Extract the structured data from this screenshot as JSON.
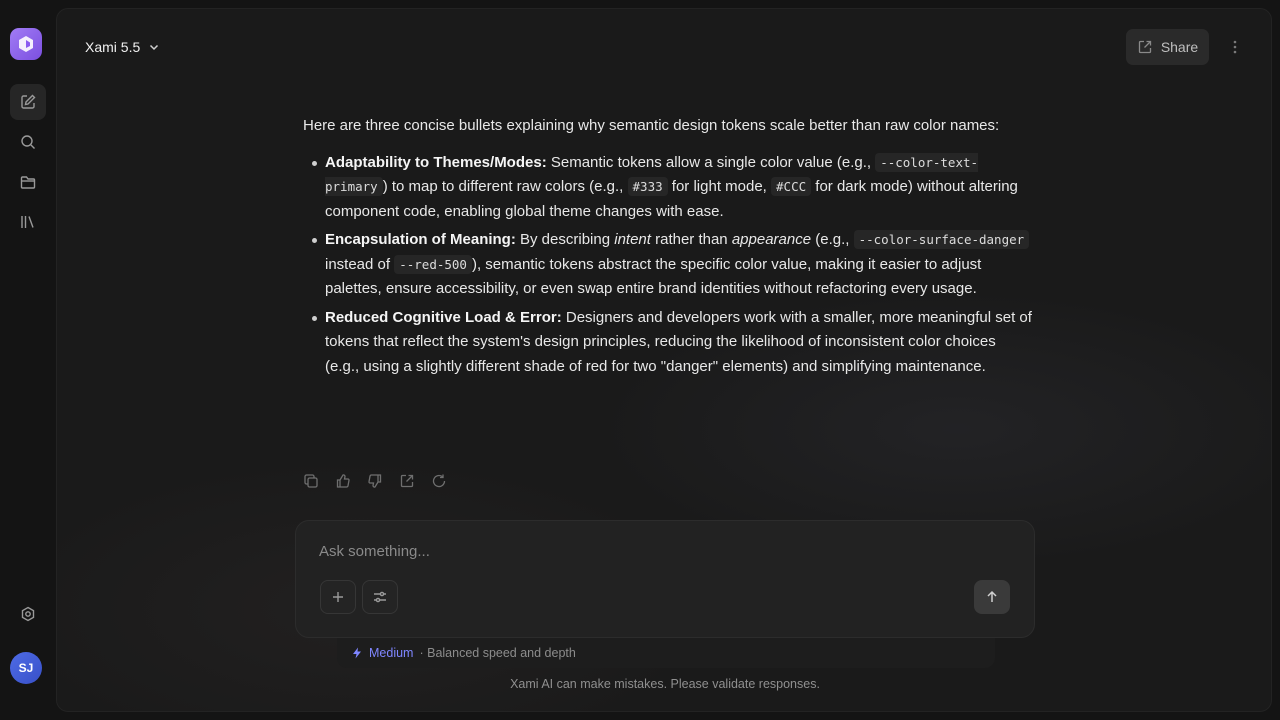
{
  "app": {
    "model_name": "Xami 5.5",
    "share_label": "Share",
    "user_initials": "SJ",
    "brand_color": "#8b5cf6"
  },
  "sidebar": {
    "items": [
      {
        "name": "new-chat",
        "icon": "edit-icon"
      },
      {
        "name": "search",
        "icon": "search-icon"
      },
      {
        "name": "projects",
        "icon": "folder-icon"
      },
      {
        "name": "library",
        "icon": "library-icon"
      },
      {
        "name": "settings",
        "icon": "gear-icon"
      }
    ]
  },
  "message": {
    "intro": "Here are three concise bullets explaining why semantic design tokens scale better than raw color names:",
    "bullets": [
      {
        "title": "Adaptability to Themes/Modes:",
        "t1": " Semantic tokens allow a single color value (e.g., ",
        "c1": "--color-text-primary",
        "t2": ") to map to different raw colors (e.g., ",
        "c2": "#333",
        "t3": " for light mode, ",
        "c3": "#CCC",
        "t4": " for dark mode) without altering component code, enabling global theme changes with ease."
      },
      {
        "title": "Encapsulation of Meaning:",
        "t1": " By describing ",
        "i1": "intent",
        "t2": " rather than ",
        "i2": "appearance",
        "t3": " (e.g., ",
        "c1": "--color-surface-danger",
        "t4": " instead of ",
        "c2": "--red-500",
        "t5": "), semantic tokens abstract the specific color value, making it easier to adjust palettes, ensure accessibility, or even swap entire brand identities without refactoring every usage."
      },
      {
        "title": "Reduced Cognitive Load & Error:",
        "t1": " Designers and developers work with a smaller, more meaningful set of tokens that reflect the system's design principles, reducing the likelihood of inconsistent color choices (e.g., using a slightly different shade of red for two \"danger\" elements) and simplifying maintenance."
      }
    ],
    "actions": [
      "copy-icon",
      "thumbs-up-icon",
      "thumbs-down-icon",
      "share-icon",
      "regenerate-icon"
    ]
  },
  "composer": {
    "placeholder": "Ask something...",
    "value": ""
  },
  "mode": {
    "name": "Medium",
    "description": "· Balanced speed and depth",
    "color": "#7f86ff"
  },
  "footer": {
    "disclaimer": "Xami AI can make mistakes. Please validate responses."
  }
}
